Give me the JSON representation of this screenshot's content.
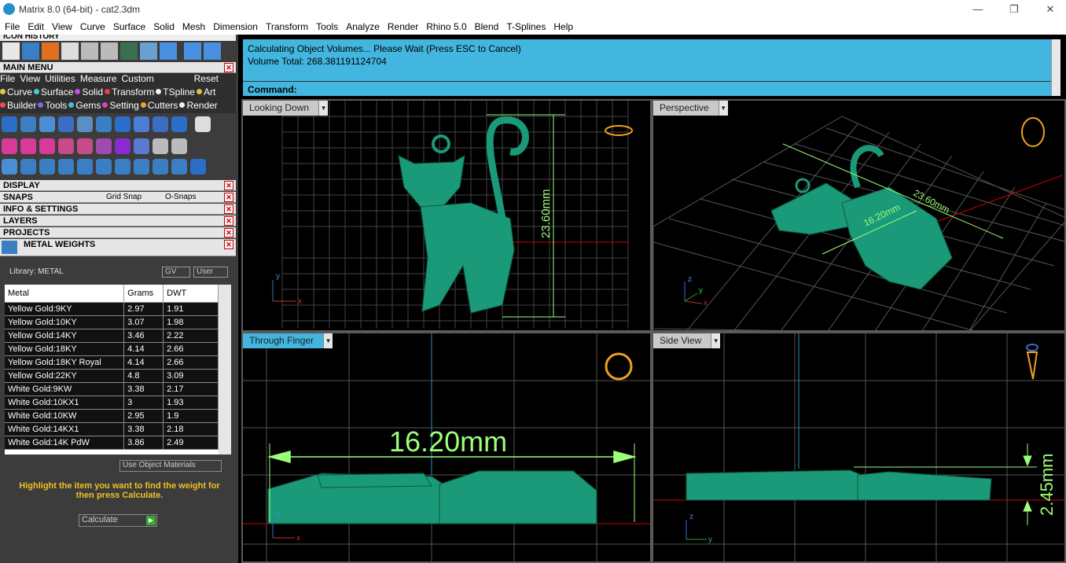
{
  "window": {
    "title": "Matrix 8.0 (64-bit) - cat2.3dm",
    "minimize": "—",
    "maximize": "❐",
    "close": "✕"
  },
  "menubar": [
    "File",
    "Edit",
    "View",
    "Curve",
    "Surface",
    "Solid",
    "Mesh",
    "Dimension",
    "Transform",
    "Tools",
    "Analyze",
    "Render",
    "Rhino 5.0",
    "Blend",
    "T-Splines",
    "Help"
  ],
  "left": {
    "icon_history": "ICON HISTORY",
    "main_menu": "MAIN MENU",
    "main_menu_items": [
      "File",
      "View",
      "Utilities",
      "Measure",
      "Custom"
    ],
    "reset": "Reset",
    "row1": [
      {
        "label": "Curve",
        "color": "#e8c84a"
      },
      {
        "label": "Surface",
        "color": "#4ad0c8"
      },
      {
        "label": "Solid",
        "color": "#c050e0"
      },
      {
        "label": "Transform",
        "color": "#e84040"
      },
      {
        "label": "TSpline",
        "color": "#f0f0f0"
      },
      {
        "label": "Art",
        "color": "#e0c040"
      }
    ],
    "row2": [
      {
        "label": "Builder",
        "color": "#e85050"
      },
      {
        "label": "Tools",
        "color": "#7070e0"
      },
      {
        "label": "Gems",
        "color": "#40c0e0"
      },
      {
        "label": "Setting",
        "color": "#e040c0"
      },
      {
        "label": "Cutters",
        "color": "#f0a030"
      },
      {
        "label": "Render",
        "color": "#f0f0f0"
      }
    ],
    "sections": {
      "display": "DISPLAY",
      "snaps": "SNAPS",
      "grid_snap": "Grid Snap",
      "osnaps": "O-Snaps",
      "info": "INFO & SETTINGS",
      "layers": "LAYERS",
      "projects": "PROJECTS",
      "metal_weights": "METAL WEIGHTS"
    },
    "library": "Library: METAL",
    "gv": "GV",
    "user": "User",
    "table": {
      "headers": [
        "Metal",
        "Grams",
        "DWT"
      ],
      "rows": [
        [
          "Yellow Gold:9KY",
          "2.97",
          "1.91"
        ],
        [
          "Yellow Gold:10KY",
          "3.07",
          "1.98"
        ],
        [
          "Yellow Gold:14KY",
          "3.46",
          "2.22"
        ],
        [
          "Yellow Gold:18KY",
          "4.14",
          "2.66"
        ],
        [
          "Yellow Gold:18KY Royal",
          "4.14",
          "2.66"
        ],
        [
          "Yellow Gold:22KY",
          "4.8",
          "3.09"
        ],
        [
          "White Gold:9KW",
          "3.38",
          "2.17"
        ],
        [
          "White Gold:10KX1",
          "3",
          "1.93"
        ],
        [
          "White Gold:10KW",
          "2.95",
          "1.9"
        ],
        [
          "White Gold:14KX1",
          "3.38",
          "2.18"
        ],
        [
          "White Gold:14K PdW",
          "3.86",
          "2.49"
        ]
      ]
    },
    "use_object_materials": "Use Object Materials",
    "hint": "Highlight the item you want to find the weight for then press Calculate.",
    "calculate": "Calculate"
  },
  "command": {
    "line1": "Calculating Object Volumes... Please Wait (Press ESC to Cancel)",
    "line2": "Volume Total: 268.381191124704",
    "prompt": "Command:"
  },
  "viewports": [
    {
      "label": "Looking Down",
      "dim": "23.60mm",
      "axes": [
        "y",
        "x"
      ]
    },
    {
      "label": "Perspective",
      "dim1": "23.60mm",
      "dim2": "16.20mm",
      "axes": [
        "z",
        "y",
        "x"
      ]
    },
    {
      "label": "Through Finger",
      "dim": "16.20mm",
      "axes": [
        "z",
        "x"
      ]
    },
    {
      "label": "Side View",
      "dim": "2.45mm",
      "axes": [
        "z",
        "y"
      ]
    }
  ],
  "colors": {
    "accent": "#42b6df",
    "model": "#1a9a78",
    "dim": "#9cff7a"
  }
}
